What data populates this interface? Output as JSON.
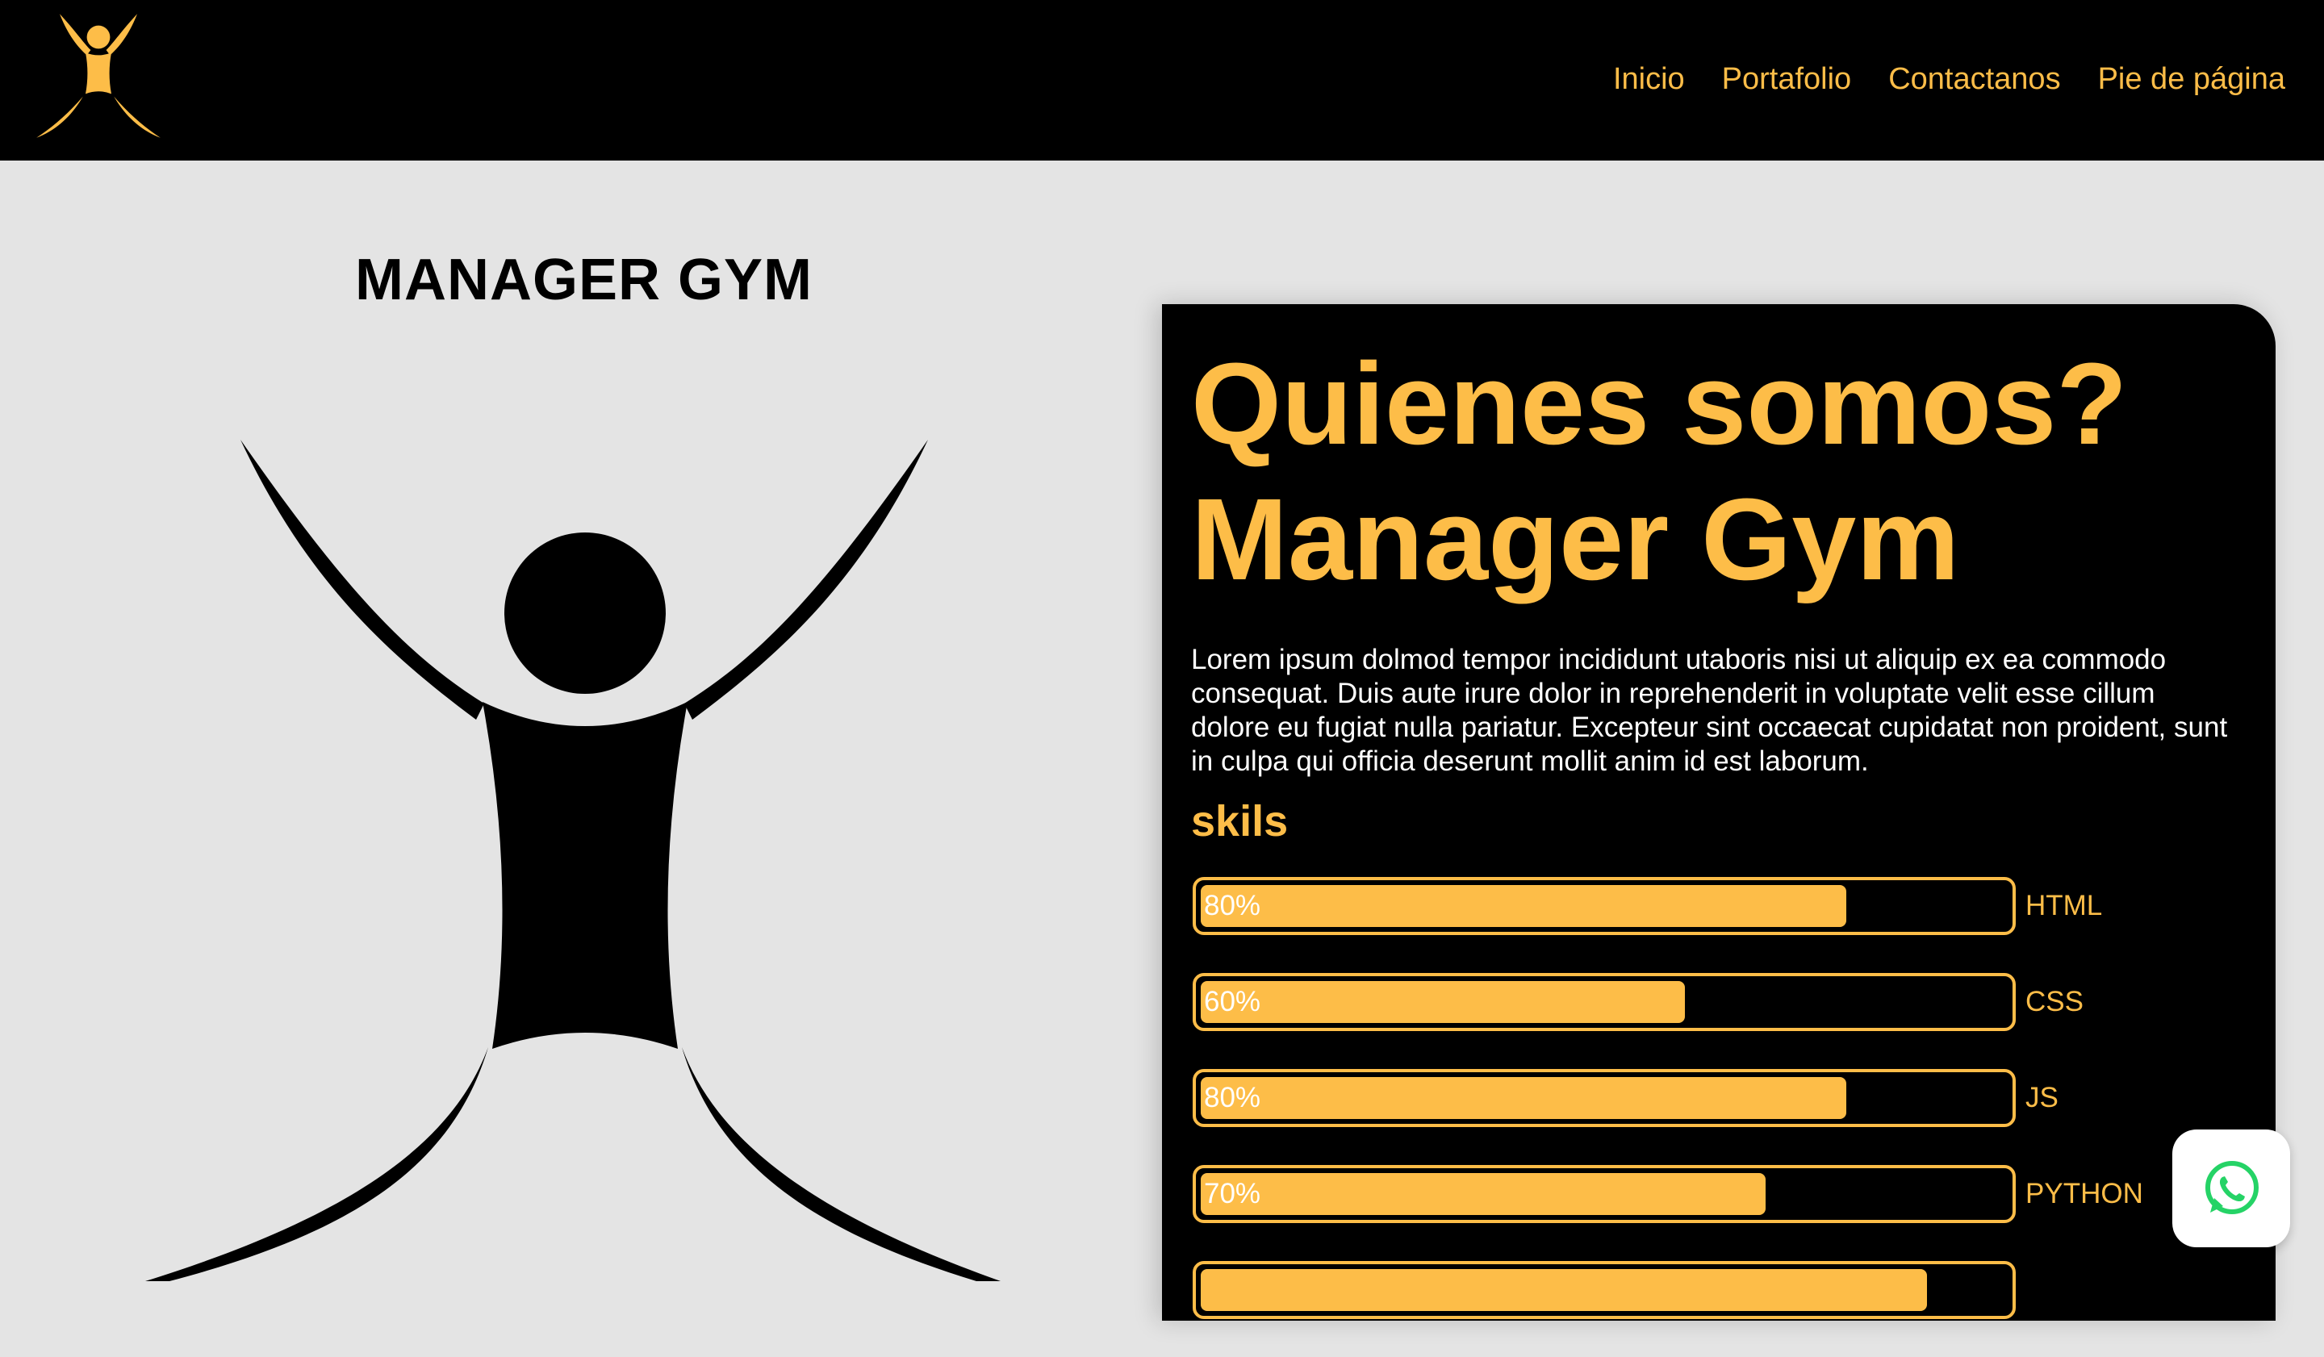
{
  "header": {
    "logo_icon": "gym-figure-logo-icon",
    "nav": [
      {
        "label": "Inicio"
      },
      {
        "label": "Portafolio"
      },
      {
        "label": "Contactanos"
      },
      {
        "label": "Pie de página"
      }
    ]
  },
  "hero": {
    "title": "MANAGER GYM",
    "figure_icon": "gym-figure-icon"
  },
  "about": {
    "heading": "Quienes somos? Manager Gym",
    "body": "Lorem ipsum dolmod tempor incididunt utaboris nisi ut aliquip ex ea commodo consequat. Duis aute irure dolor in reprehenderit in voluptate velit esse cillum dolore eu fugiat nulla pariatur. Excepteur sint occaecat cupidatat non proident, sunt in culpa qui officia deserunt mollit anim id est laborum.",
    "skills_title": "skils",
    "skills": [
      {
        "percent_label": "80%",
        "value": 80,
        "name": "HTML"
      },
      {
        "percent_label": "60%",
        "value": 60,
        "name": "CSS"
      },
      {
        "percent_label": "80%",
        "value": 80,
        "name": "JS"
      },
      {
        "percent_label": "70%",
        "value": 70,
        "name": "PYTHON"
      },
      {
        "percent_label": "",
        "value": 90,
        "name": ""
      }
    ]
  },
  "floating": {
    "whatsapp_icon": "whatsapp-icon"
  },
  "colors": {
    "accent": "#fdbd48",
    "dark": "#000000",
    "background": "#e4e4e4",
    "whatsapp": "#25d366"
  }
}
